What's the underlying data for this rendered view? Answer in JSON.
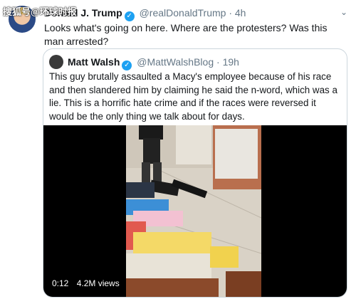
{
  "watermark": "搜狐号@环球时报",
  "tweet": {
    "author_name": "Donald J. Trump",
    "handle": "@realDonaldTrump",
    "time": "4h",
    "text": "Looks what's going on here. Where are the protesters? Was this man arrested?"
  },
  "quoted": {
    "author_name": "Matt Walsh",
    "handle": "@MattWalshBlog",
    "time": "19h",
    "text": "This guy brutally assaulted a Macy's employee because of his race and then slandered him by claiming he said the n-word, which was a lie. This is a horrific hate crime and if the races were reversed it would be the only thing we talk about for days.",
    "video": {
      "duration": "0:12",
      "views": "4.2M views"
    }
  },
  "icons": {
    "verified": "verified-badge-icon",
    "caret": "chevron-down-icon"
  },
  "colors": {
    "accent": "#1da1f2",
    "muted": "#657786",
    "border": "#ccd6dd"
  }
}
